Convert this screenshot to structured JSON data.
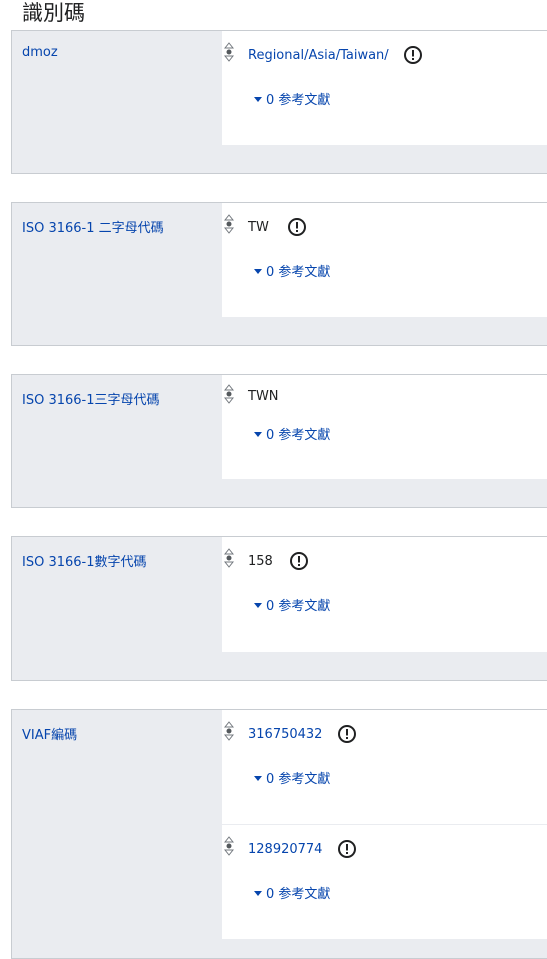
{
  "section": {
    "heading": "識別碼"
  },
  "statements": [
    {
      "property": "dmoz",
      "values": [
        {
          "value": "Regional/Asia/Taiwan/",
          "is_link": true,
          "warning_icon": true,
          "references": "0 参考文獻"
        }
      ]
    },
    {
      "property": "ISO 3166-1 二字母代碼",
      "values": [
        {
          "value": "TW",
          "is_link": false,
          "warning_icon": true,
          "references": "0 参考文獻"
        }
      ]
    },
    {
      "property": "ISO 3166-1三字母代碼",
      "values": [
        {
          "value": "TWN",
          "is_link": false,
          "warning_icon": false,
          "references": "0 参考文獻"
        }
      ]
    },
    {
      "property": "ISO 3166-1數字代碼",
      "values": [
        {
          "value": "158",
          "is_link": false,
          "warning_icon": true,
          "references": "0 参考文獻"
        }
      ]
    },
    {
      "property": "VIAF編碼",
      "values": [
        {
          "value": "316750432",
          "is_link": true,
          "warning_icon": true,
          "references": "0 参考文獻"
        },
        {
          "value": "128920774",
          "is_link": true,
          "warning_icon": true,
          "references": "0 参考文獻"
        }
      ]
    }
  ],
  "icons": {
    "rank": "rank-selector-icon",
    "warning": "exclamation-circle-icon",
    "expand": "triangle-down-icon"
  },
  "colors": {
    "link": "#0645ad",
    "label_bg": "#eaecf0",
    "border": "#c8ccd1",
    "text": "#202122"
  }
}
